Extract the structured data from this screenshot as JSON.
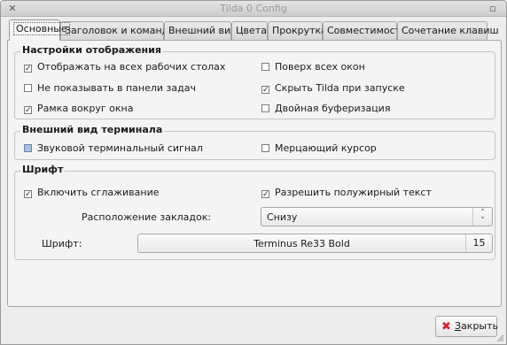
{
  "window": {
    "title": "Tilda 0 Config"
  },
  "tabs": [
    {
      "label": "Основные"
    },
    {
      "label": "Заголовок и команда"
    },
    {
      "label": "Внешний вид"
    },
    {
      "label": "Цвета"
    },
    {
      "label": "Прокрутка"
    },
    {
      "label": "Совместимость"
    },
    {
      "label": "Сочетание клавиш"
    }
  ],
  "display": {
    "title": "Настройки отображения",
    "options": [
      {
        "label": "Отображать на всех рабочих столах",
        "checked": true
      },
      {
        "label": "Поверх всех окон",
        "checked": false
      },
      {
        "label": "Не показывать в панели задач",
        "checked": false
      },
      {
        "label": "Скрыть Tilda при запуске",
        "checked": true
      },
      {
        "label": "Рамка вокруг окна",
        "checked": true
      },
      {
        "label": "Двойная буферизация",
        "checked": false
      }
    ]
  },
  "terminal": {
    "title": "Внешний вид терминала",
    "options": [
      {
        "label": "Звуковой терминальный сигнал",
        "checked": "indeterminate"
      },
      {
        "label": "Мерцающий курсор",
        "checked": false
      }
    ]
  },
  "font": {
    "title": "Шрифт",
    "antialias": {
      "label": "Включить сглаживание",
      "checked": true
    },
    "bold": {
      "label": "Разрешить полужирный текст",
      "checked": true
    },
    "tab_position_label": "Расположение закладок:",
    "tab_position_value": "Снизу",
    "font_label": "Шрифт:",
    "font_name": "Terminus Re33 Bold",
    "font_size": "15"
  },
  "buttons": {
    "close": "Закрыть",
    "close_mnemonic": "З",
    "close_rest": "акрыть"
  }
}
